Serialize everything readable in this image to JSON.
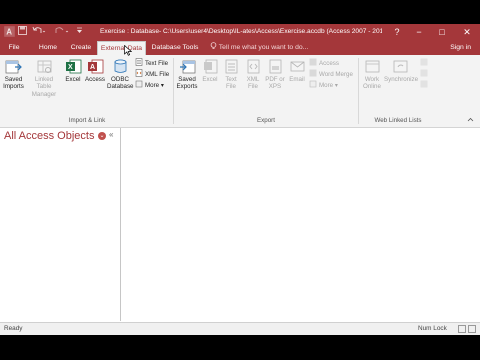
{
  "window": {
    "title": "Exercise : Database- C:\\Users\\user4\\Desktop\\IL-ates\\Access\\Exercise.accdb (Access 2007 - 2016 file f...",
    "help": "?",
    "minimize": "−",
    "maximize": "□",
    "close": "✕"
  },
  "tabs": [
    {
      "label": "File"
    },
    {
      "label": "Home"
    },
    {
      "label": "Create"
    },
    {
      "label": "External Data"
    },
    {
      "label": "Database Tools"
    }
  ],
  "tell_me": "Tell me what you want to do...",
  "sign_in": "Sign in",
  "ribbon": {
    "import_link": {
      "label": "Import & Link",
      "saved_imports": "Saved Imports",
      "linked_table_manager": "Linked Table Manager",
      "excel": "Excel",
      "access": "Access",
      "odbc": "ODBC Database",
      "text_file": "Text File",
      "xml_file": "XML File",
      "more": "More"
    },
    "export": {
      "label": "Export",
      "saved_exports": "Saved Exports",
      "excel": "Excel",
      "text_file": "Text File",
      "xml_file": "XML File",
      "pdf_xps": "PDF or XPS",
      "email": "Email",
      "access": "Access",
      "word_merge": "Word Merge",
      "more": "More"
    },
    "web": {
      "label": "Web Linked Lists",
      "work_online": "Work Online",
      "synchronize": "Synchronize"
    }
  },
  "nav_pane": {
    "title": "All Access Objects",
    "collapse": "«"
  },
  "status": {
    "left": "Ready",
    "num_lock": "Num Lock"
  },
  "colors": {
    "accent": "#a4373a",
    "excel_green": "#1e7145",
    "access_red": "#a4373a"
  }
}
